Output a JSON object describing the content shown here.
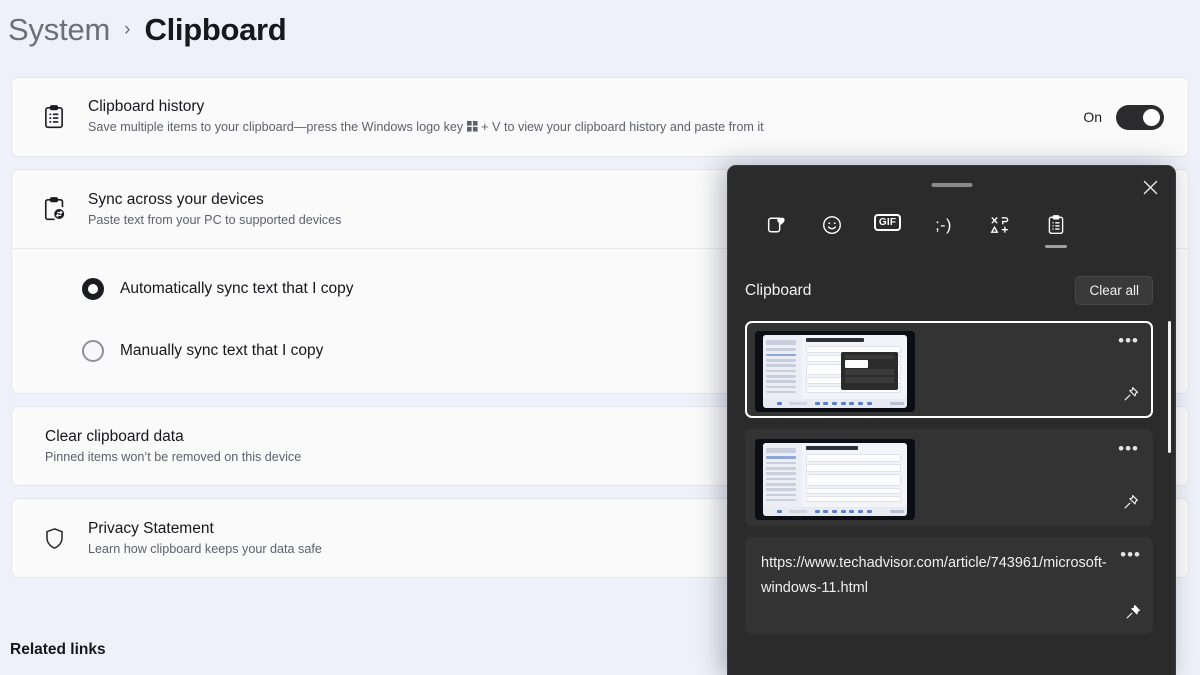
{
  "breadcrumb": {
    "parent": "System",
    "separator": "›",
    "current": "Clipboard"
  },
  "settings": {
    "clipboard_history": {
      "icon": "clipboard-list-icon",
      "title": "Clipboard history",
      "subtitle_before": "Save multiple items to your clipboard—press the Windows logo key ",
      "subtitle_after": " + V to view your clipboard history and paste from it",
      "toggle_label": "On",
      "toggle_state": "on"
    },
    "sync": {
      "icon": "clipboard-sync-icon",
      "title": "Sync across your devices",
      "subtitle": "Paste text from your PC to supported devices",
      "options": [
        {
          "label": "Automatically sync text that I copy",
          "selected": true
        },
        {
          "label": "Manually sync text that I copy",
          "selected": false
        }
      ]
    },
    "clear_data": {
      "title": "Clear clipboard data",
      "subtitle": "Pinned items won’t be removed on this device"
    },
    "privacy": {
      "icon": "shield-icon",
      "title": "Privacy Statement",
      "subtitle": "Learn how clipboard keeps your data safe"
    },
    "related_links": "Related links"
  },
  "flyout": {
    "close_icon": "close-icon",
    "drag_handle": "drag-handle",
    "tabs": [
      {
        "name": "recent-stickers-icon",
        "label": "",
        "active": false
      },
      {
        "name": "emoji-icon",
        "label": "",
        "active": false
      },
      {
        "name": "gif-icon",
        "label": "GIF",
        "active": false
      },
      {
        "name": "kaomoji-icon",
        "label": ";-)",
        "active": false
      },
      {
        "name": "symbols-icon",
        "label": "",
        "active": false
      },
      {
        "name": "clipboard-icon",
        "label": "",
        "active": true
      }
    ],
    "header_title": "Clipboard",
    "clear_all_label": "Clear all",
    "items": [
      {
        "type": "image",
        "name": "clipboard-item-screenshot-1",
        "selected": true,
        "menu": "•••",
        "pin": "pin-icon"
      },
      {
        "type": "image",
        "name": "clipboard-item-screenshot-2",
        "selected": false,
        "menu": "•••",
        "pin": "pin-icon"
      },
      {
        "type": "text",
        "name": "clipboard-item-url",
        "selected": false,
        "text": "https://www.techadvisor.com/article/743961/microsoft-windows-11.html",
        "menu": "•••",
        "pin": "pin-icon"
      }
    ]
  },
  "colors": {
    "page_background": "#eef1f9",
    "card_background": "#fafafa",
    "flyout_background": "#2b2b2b",
    "flyout_item_background": "#333333",
    "accent_text": "#16171b",
    "muted_text": "#5d616a",
    "toggle_on": "#2b2b2e"
  }
}
